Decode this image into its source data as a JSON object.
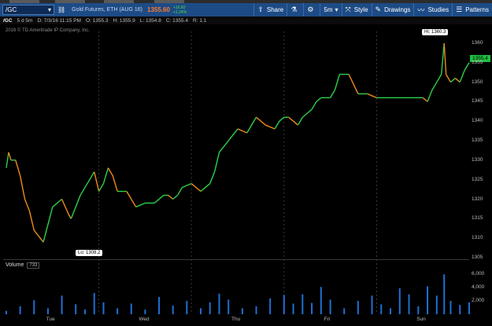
{
  "toolbar": {
    "symbol": "/GC",
    "description": "Gold Futures, ETH (AUG 16)",
    "price": "1355.60",
    "change_abs": "+16.60",
    "change_pct": "+1.24%",
    "share_label": "Share",
    "interval_label": "5m",
    "style_label": "Style",
    "drawings_label": "Drawings",
    "studies_label": "Studies",
    "patterns_label": "Patterns"
  },
  "infobar": {
    "symbol": "/GC",
    "period": "5 d 5m",
    "date": "D: 7/3/16 11:15 PM",
    "open": "O: 1355.3",
    "high": "H: 1355.9",
    "low": "L: 1354.8",
    "close": "C: 1355.4",
    "range": "R: 1.1"
  },
  "copyright": "2016 © TD Ameritrade IP Company, Inc.",
  "markers": {
    "hi": "Hi: 1360.3",
    "lo": "Lo: 1308.2",
    "last": "1355.4"
  },
  "volume": {
    "label": "Volume",
    "value": "733",
    "ticks": [
      {
        "label": "6,000",
        "v": 6000
      },
      {
        "label": "4,000",
        "v": 4000
      },
      {
        "label": "2,000",
        "v": 2000
      }
    ]
  },
  "colors": {
    "up": "#2cd14a",
    "down": "#f08a1a",
    "toolbar": "#1d4b86",
    "last_price": "#1fbf3f"
  },
  "chart_data": {
    "type": "line",
    "ylim": [
      1305,
      1363
    ],
    "y_ticks": [
      "1360",
      "1355",
      "1350",
      "1345",
      "1340",
      "1335",
      "1330",
      "1325",
      "1320",
      "1315",
      "1310",
      "1305"
    ],
    "x_days": [
      "Tue",
      "Wed",
      "Thu",
      "Fri",
      "Sun"
    ],
    "series": [
      {
        "x": [
          0,
          0.5,
          1,
          2,
          3,
          4,
          5,
          6,
          8,
          10,
          12,
          13.5,
          14,
          16,
          18,
          19,
          20,
          21,
          22,
          23,
          24,
          26,
          27,
          28,
          30,
          32,
          34,
          35,
          36,
          37,
          38,
          40,
          42,
          44,
          45,
          46,
          48,
          50,
          52,
          54,
          56,
          58,
          59,
          60,
          61,
          62,
          63,
          64,
          65,
          66,
          67,
          68,
          69,
          70,
          71,
          72,
          74,
          76,
          78,
          80,
          82,
          84,
          86,
          88,
          90,
          91,
          92,
          93,
          94,
          94.6,
          95,
          96,
          97,
          98,
          99,
          100
        ],
        "values": [
          1328,
          1332,
          1330,
          1330,
          1326,
          1320,
          1317,
          1312,
          1309,
          1318,
          1320,
          1316,
          1315,
          1321,
          1325,
          1327,
          1322,
          1324,
          1328,
          1326,
          1322,
          1322,
          1320,
          1318,
          1319,
          1319,
          1321,
          1321,
          1320,
          1321,
          1323,
          1324,
          1322,
          1324,
          1327,
          1332,
          1335,
          1338,
          1337,
          1341,
          1339,
          1338,
          1340,
          1341,
          1341,
          1340,
          1339,
          1341,
          1342,
          1343,
          1345,
          1346,
          1346,
          1346,
          1348,
          1352,
          1352,
          1347,
          1347,
          1346,
          1346,
          1346,
          1346,
          1346,
          1346,
          1345,
          1348,
          1350,
          1352,
          1360,
          1352,
          1350,
          1351,
          1350,
          1353,
          1355
        ]
      }
    ],
    "volume": {
      "ylim": [
        0,
        6500
      ],
      "x": [
        0,
        3,
        6,
        9,
        12,
        15,
        17,
        19,
        21,
        24,
        27,
        30,
        33,
        36,
        39,
        42,
        44,
        46,
        48,
        51,
        54,
        57,
        60,
        62,
        64,
        66,
        68,
        70,
        73,
        76,
        79,
        81,
        83,
        85,
        87,
        89,
        91,
        93,
        94.6,
        96,
        98,
        100
      ],
      "values": [
        500,
        1200,
        2100,
        900,
        2800,
        1500,
        700,
        3200,
        1800,
        900,
        1600,
        700,
        2600,
        1300,
        2000,
        900,
        1800,
        3100,
        2200,
        900,
        1200,
        2400,
        2900,
        1600,
        3000,
        1700,
        4100,
        2200,
        900,
        2000,
        2800,
        1500,
        900,
        3900,
        3000,
        1200,
        4200,
        2800,
        6000,
        2000,
        1400,
        1800
      ]
    }
  }
}
